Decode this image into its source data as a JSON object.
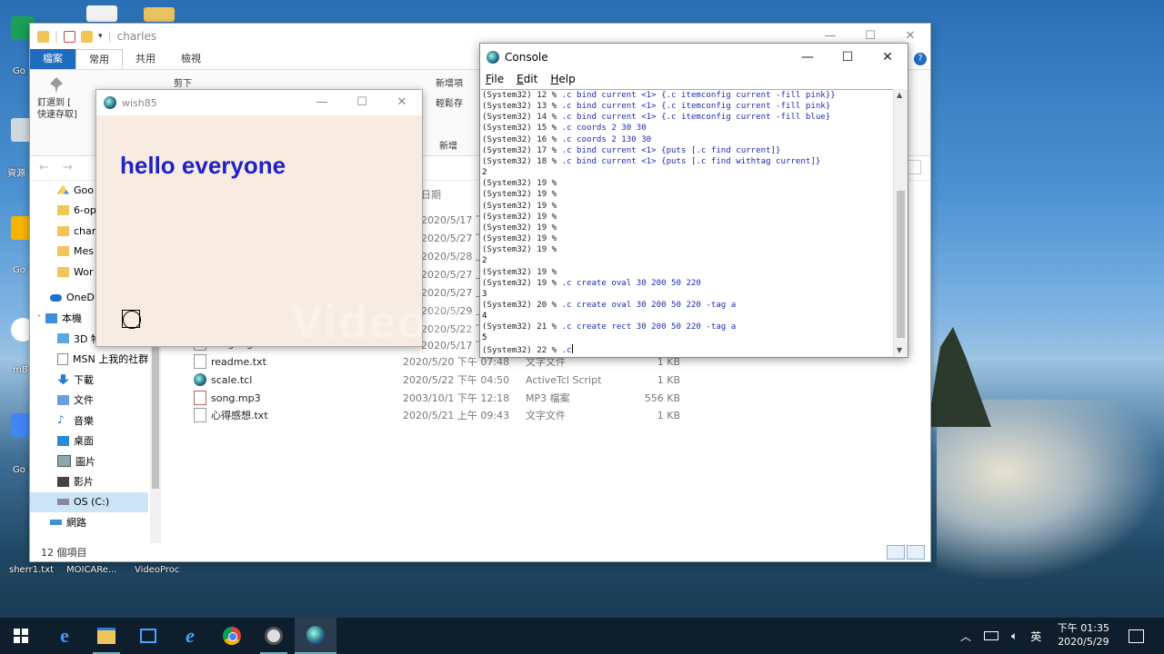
{
  "desktop": {
    "labels": [
      "Go Sh",
      "資源",
      "Go Sli",
      "mB",
      "Go Da",
      "sherr1.txt",
      "MOICARe...",
      "VideoProc"
    ]
  },
  "explorer": {
    "title": "charles",
    "ribbon_tabs": [
      "檔案",
      "常用",
      "共用",
      "檢視"
    ],
    "ribbon": {
      "pin": "釘選到 [ 快速存取]",
      "cut": "剪下",
      "new_item": "新增項",
      "shortcut": "輕鬆存",
      "new_group": "新增"
    },
    "column_date": "日期",
    "nav": [
      "Goo",
      "6-op",
      "char",
      "Mes",
      "Wor",
      "OneD",
      "本機",
      "3D 物件",
      "MSN 上我的社群",
      "下載",
      "文件",
      "音樂",
      "桌面",
      "圖片",
      "影片",
      "OS (C:)",
      "網路"
    ],
    "partial_dates": [
      "2020/5/17 下午",
      "2020/5/27 下午",
      "2020/5/28 上午",
      "2020/5/27 上午",
      "2020/5/27 上午",
      "2020/5/29 上午",
      "2020/5/22 下午",
      "2020/5/17 下午"
    ],
    "partial_file": "ranger.gif",
    "files": [
      {
        "name": "readme.txt",
        "date": "2020/5/20 下午 07:48",
        "type": "文字文件",
        "size": "1 KB"
      },
      {
        "name": "scale.tcl",
        "date": "2020/5/22 下午 04:50",
        "type": "ActiveTcl Script",
        "size": "1 KB"
      },
      {
        "name": "song.mp3",
        "date": "2003/10/1 下午 12:18",
        "type": "MP3 檔案",
        "size": "556 KB"
      },
      {
        "name": "心得感想.txt",
        "date": "2020/5/21 上午 09:43",
        "type": "文字文件",
        "size": "1 KB"
      }
    ],
    "status": "12 個項目"
  },
  "wish": {
    "title": "wish85",
    "canvas_text": "hello everyone"
  },
  "console": {
    "title": "Console",
    "menu": [
      "File",
      "Edit",
      "Help"
    ],
    "lines": [
      {
        "p": "(System32) 12 % ",
        "c": ".c bind current <1> {.c itemconfig current -fill pink}}"
      },
      {
        "p": "(System32) 13 % ",
        "c": ".c bind current <1> {.c itemconfig current -fill pink}"
      },
      {
        "p": "(System32) 14 % ",
        "c": ".c bind current <1> {.c itemconfig current -fill blue}"
      },
      {
        "p": "(System32) 15 % ",
        "c": ".c coords 2 30 30"
      },
      {
        "p": "(System32) 16 % ",
        "c": ".c coords 2 130 30"
      },
      {
        "p": "(System32) 17 % ",
        "c": ".c bind current <1> {puts [.c find current]}"
      },
      {
        "p": "(System32) 18 % ",
        "c": ".c bind current <1> {puts [.c find withtag current]}"
      },
      {
        "o": "2"
      },
      {
        "p": "(System32) 19 % ",
        "c": ""
      },
      {
        "p": "(System32) 19 % ",
        "c": ""
      },
      {
        "p": "(System32) 19 % ",
        "c": ""
      },
      {
        "p": "(System32) 19 % ",
        "c": ""
      },
      {
        "p": "(System32) 19 % ",
        "c": ""
      },
      {
        "p": "(System32) 19 % ",
        "c": ""
      },
      {
        "p": "(System32) 19 % ",
        "c": ""
      },
      {
        "o": "2"
      },
      {
        "p": "(System32) 19 % ",
        "c": ""
      },
      {
        "p": "(System32) 19 % ",
        "c": ".c create oval 30 200 50 220"
      },
      {
        "o": "3"
      },
      {
        "p": "(System32) 20 % ",
        "c": ".c create oval 30 200 50 220 -tag a"
      },
      {
        "o": "4"
      },
      {
        "p": "(System32) 21 % ",
        "c": ".c create rect 30 200 50 220 -tag a"
      },
      {
        "o": "5"
      },
      {
        "p": "(System32) 22 % ",
        "c": ".c"
      }
    ]
  },
  "watermark": "VideoProc Recorder",
  "taskbar": {
    "ime": "英",
    "time": "下午 01:35",
    "date": "2020/5/29"
  },
  "colors": {
    "canvas_text": "#1e22c8",
    "command_text": "#1d2bb0",
    "file_tab": "#1e6bbf"
  }
}
